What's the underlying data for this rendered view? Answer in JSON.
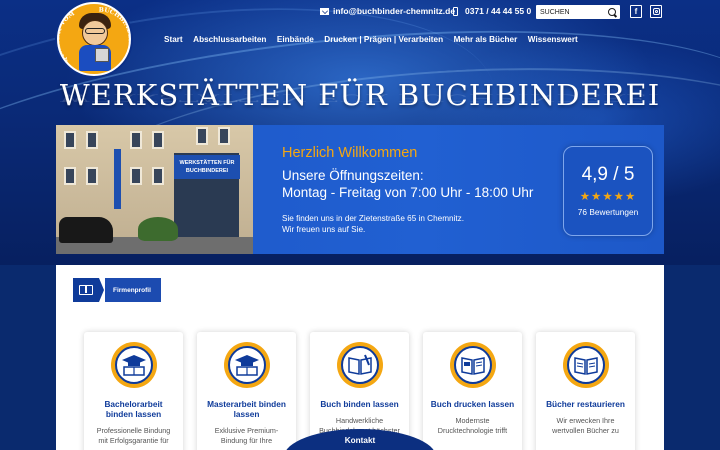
{
  "topbar": {
    "email": "info@buchbinder-chemnitz.de",
    "phone": "0371 / 44 44 55 0",
    "search_placeholder": "SUCHEN",
    "facebook_glyph": "f"
  },
  "logo": {
    "ring_text_left": "QUALITÄT VOM",
    "ring_text_right": "BUCHBINDER"
  },
  "nav": {
    "items": [
      "Start",
      "Abschlussarbeiten",
      "Einbände",
      "Drucken | Prägen | Verarbeiten",
      "Mehr als Bücher",
      "Wissenswert"
    ]
  },
  "hero": {
    "title": "WERKSTÄTTEN FÜR BUCHBINDEREI"
  },
  "photo": {
    "shop_sign": "WERKSTÄTTEN FÜR BUCHBINDEREI"
  },
  "welcome": {
    "heading": "Herzlich Willkommen",
    "hours_line1": "Unsere Öffnungszeiten:",
    "hours_line2": "Montag - Freitag von 7:00 Uhr - 18:00 Uhr",
    "address_line1": "Sie finden uns in der Zietenstraße 65 in Chemnitz.",
    "address_line2": "Wir freuen uns auf Sie."
  },
  "rating": {
    "score": "4,9 / 5",
    "stars": "★★★★★",
    "count": "76 Bewertungen"
  },
  "breadcrumb": {
    "label": "Firmenprofil"
  },
  "cards": [
    {
      "title": "Bachelorarbeit binden lassen",
      "text": "Professionelle Bindung mit Erfolgsgarantie für",
      "icon": "graduation-book-icon"
    },
    {
      "title": "Masterarbeit binden lassen",
      "text": "Exklusive Premium-Bindung für Ihre",
      "icon": "graduation-book-icon"
    },
    {
      "title": "Buch binden lassen",
      "text": "Handwerkliche Buchbindekunst höchster",
      "icon": "open-book-icon"
    },
    {
      "title": "Buch drucken lassen",
      "text": "Modernste Drucktechnologie trifft",
      "icon": "printed-book-icon"
    },
    {
      "title": "Bücher restaurieren",
      "text": "Wir erwecken Ihre wertvollen Bücher zu",
      "icon": "restore-book-icon"
    }
  ],
  "contact": {
    "label": "Kontakt"
  },
  "colors": {
    "brand_blue": "#0f3b9a",
    "accent_gold": "#f4a712",
    "panel_blue": "#1c56c6"
  }
}
